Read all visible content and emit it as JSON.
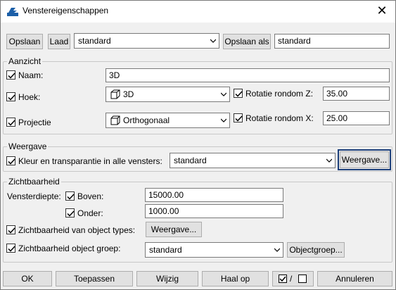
{
  "window": {
    "title": "Venstereigenschappen",
    "app_icon": "window-properties-icon",
    "close_icon": "close-icon",
    "close_glyph": "✕"
  },
  "preset": {
    "save_label": "Opslaan",
    "load_label": "Laad",
    "preset_value": "standard",
    "save_as_label": "Opslaan als",
    "save_as_value": "standard"
  },
  "aanzicht": {
    "group_label": "Aanzicht",
    "naam_label": "Naam:",
    "naam_value": "3D",
    "hoek_label": "Hoek:",
    "hoek_value": "3D",
    "rot_z_label": "Rotatie rondom Z:",
    "rot_z_value": "35.00",
    "projectie_label": "Projectie",
    "projectie_value": "Orthogonaal",
    "rot_x_label": "Rotatie rondom X:",
    "rot_x_value": "25.00"
  },
  "weergave": {
    "group_label": "Weergave",
    "kleur_label": "Kleur en transparantie in alle vensters:",
    "kleur_value": "standard",
    "weergave_button": "Weergave..."
  },
  "zichtbaarheid": {
    "group_label": "Zichtbaarheid",
    "diepte_label": "Vensterdiepte:",
    "boven_label": "Boven:",
    "boven_value": "15000.00",
    "onder_label": "Onder:",
    "onder_value": "1000.00",
    "object_types_label": "Zichtbaarheid van object types:",
    "object_types_button": "Weergave...",
    "object_groep_label": "Zichtbaarheid object groep:",
    "object_groep_value": "standard",
    "object_groep_button": "Objectgroep..."
  },
  "footer": {
    "ok": "OK",
    "toepassen": "Toepassen",
    "wijzig": "Wijzig",
    "haal_op": "Haal op",
    "toggle_slash": "/",
    "annuleren": "Annuleren"
  },
  "colors": {
    "focus_border": "#1c3f7a",
    "titlebar": "#ffffff",
    "dialog_bg": "#f0f0f0"
  }
}
